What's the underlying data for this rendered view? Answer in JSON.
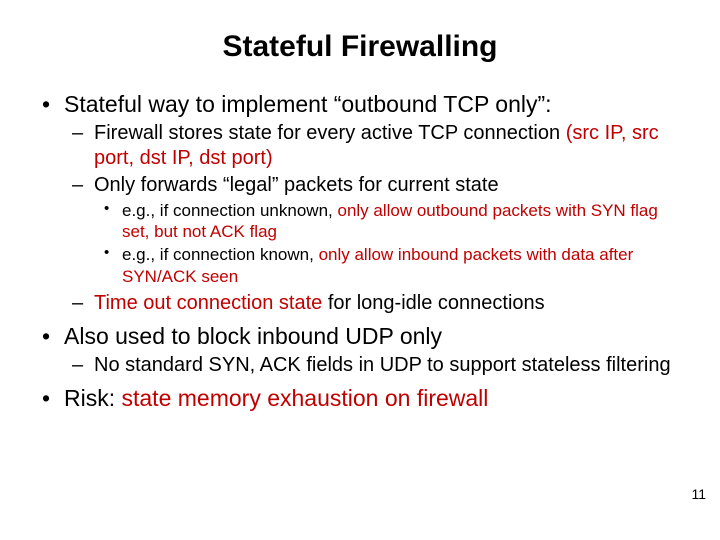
{
  "title": "Stateful Firewalling",
  "page_number": "11",
  "bullets": {
    "b1": {
      "text": "Stateful way to implement “outbound TCP only”:",
      "sub": {
        "s1a": "Firewall stores state for every active TCP connection ",
        "s1a_red": "(src IP, src port, dst IP, dst port)",
        "s1b": "Only forwards “legal” packets for current state",
        "s1b_sub": {
          "x1a": "e.g., if connection unknown, ",
          "x1b_red": "only allow outbound packets with SYN flag set, but not ACK flag",
          "x2a": "e.g., if connection known, ",
          "x2b_red": "only allow inbound packets with data after SYN/ACK seen"
        },
        "s1c_a": "Time out connection state",
        "s1c_b": " for long-idle connections"
      }
    },
    "b2": {
      "text": "Also used to block inbound UDP only",
      "sub": {
        "s2a": "No standard SYN, ACK fields in UDP to support stateless filtering"
      }
    },
    "b3": {
      "a": "Risk: ",
      "b_red": "state memory exhaustion on firewall"
    }
  }
}
